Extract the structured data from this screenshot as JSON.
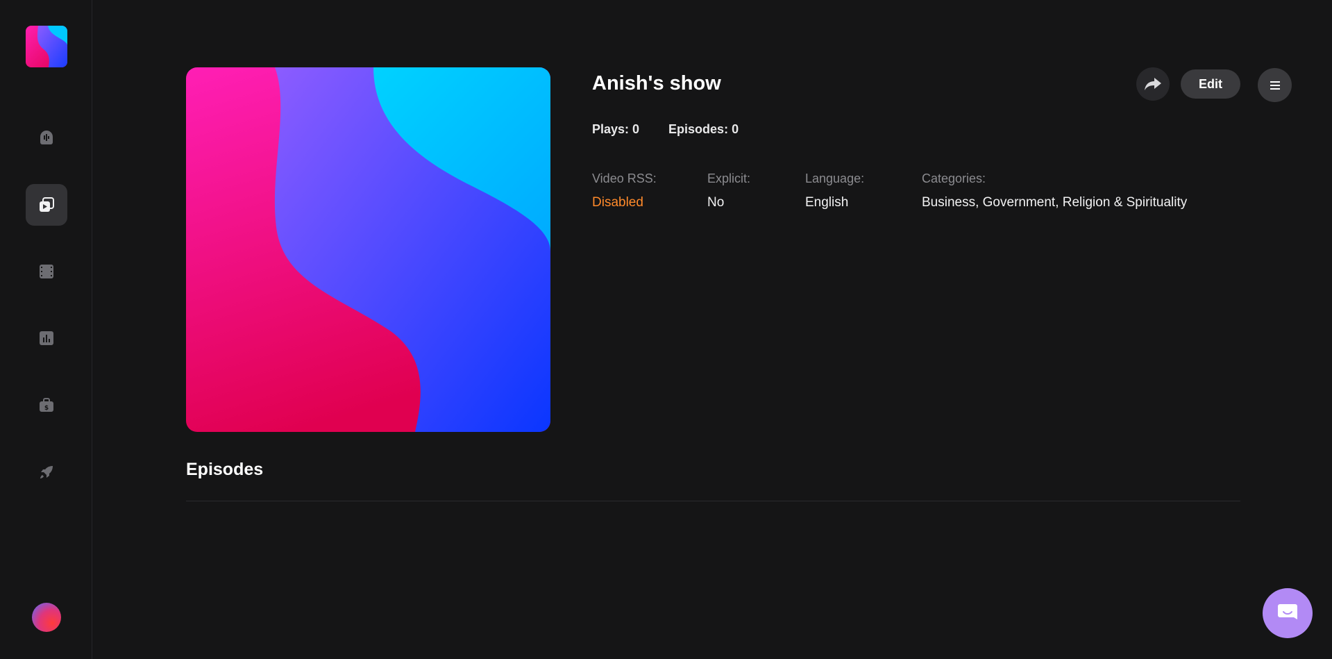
{
  "sidebar": {
    "logo_icon": "brand-logo",
    "items": [
      {
        "icon": "podcast-icon",
        "active": false
      },
      {
        "icon": "shows-icon",
        "active": true
      },
      {
        "icon": "film-icon",
        "active": false
      },
      {
        "icon": "analytics-icon",
        "active": false
      },
      {
        "icon": "monetization-icon",
        "active": false
      },
      {
        "icon": "rocket-icon",
        "active": false
      }
    ],
    "avatar_icon": "user-avatar"
  },
  "show": {
    "title": "Anish's show",
    "plays": "Plays: 0",
    "episodes_count": "Episodes: 0",
    "meta": {
      "video_rss_label": "Video RSS:",
      "video_rss_value": "Disabled",
      "explicit_label": "Explicit:",
      "explicit_value": "No",
      "language_label": "Language:",
      "language_value": "English",
      "categories_label": "Categories:",
      "categories_value": "Business, Government, Religion & Spirituality"
    }
  },
  "actions": {
    "share_icon": "share-icon",
    "edit_label": "Edit",
    "menu_icon": "hamburger-icon"
  },
  "episodes": {
    "title": "Episodes"
  },
  "colors": {
    "background": "#151516",
    "accent_orange": "#ff8a2b",
    "chat_purple": "#b28af5"
  }
}
